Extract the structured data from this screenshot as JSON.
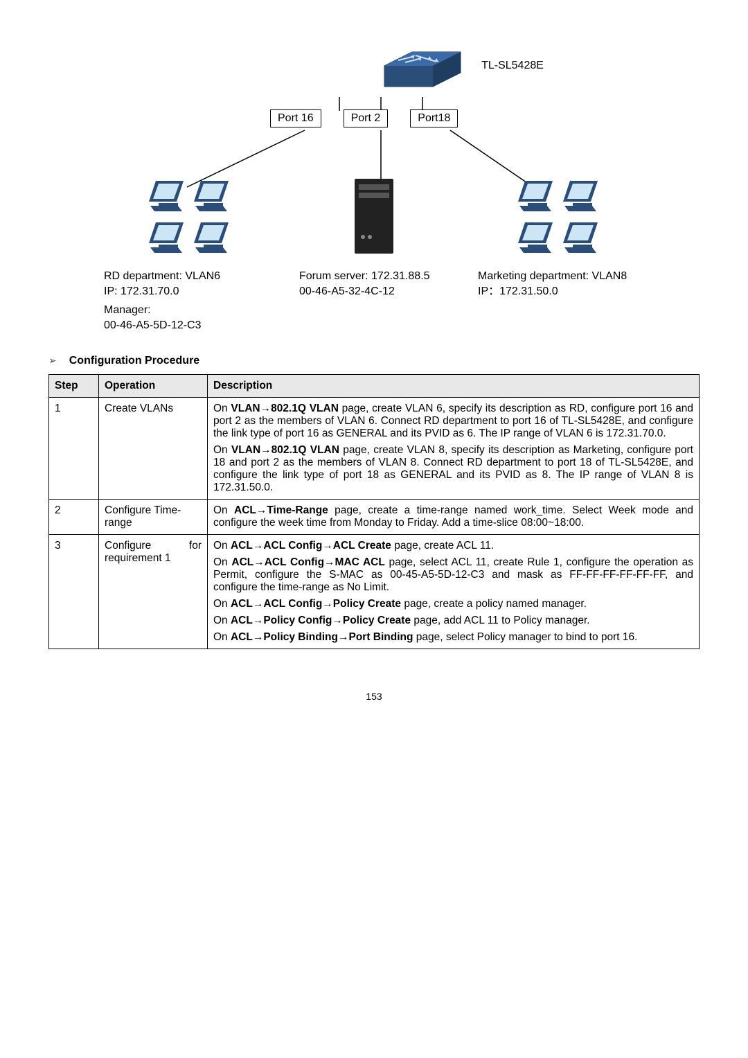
{
  "diagram": {
    "switch_label": "TL-SL5428E",
    "port16": "Port 16",
    "port2": "Port 2",
    "port18": "Port18",
    "rd_line1": "RD department: VLAN6",
    "rd_line2": "IP: 172.31.70.0",
    "manager_line1": "Manager:",
    "manager_line2": "00-46-A5-5D-12-C3",
    "forum_line1": "Forum server: 172.31.88.5",
    "forum_line2": "00-46-A5-32-4C-12",
    "mkt_line1": "Marketing department: VLAN8",
    "mkt_line2": "IP：172.31.50.0"
  },
  "procedure_heading": "Configuration Procedure",
  "table": {
    "h_step": "Step",
    "h_op": "Operation",
    "h_desc": "Description",
    "r1_step": "1",
    "r1_op": "Create VLANs",
    "r1_p1a": "On ",
    "r1_p1b": "VLAN→802.1Q VLAN",
    "r1_p1c": " page, create VLAN 6, specify its description as RD, configure port 16 and port 2 as the members of VLAN 6. Connect RD department to port 16 of TL-SL5428E, and configure the link type of port 16 as GENERAL and its PVID as 6. The IP range of VLAN 6 is 172.31.70.0.",
    "r1_p2a": "On ",
    "r1_p2b": "VLAN→802.1Q VLAN",
    "r1_p2c": " page, create VLAN 8, specify its description as Marketing, configure port 18 and port 2 as the members of VLAN 8. Connect RD department to port 18 of TL-SL5428E, and configure the link type of port 18 as GENERAL and its PVID as 8. The IP range of VLAN 8 is 172.31.50.0.",
    "r2_step": "2",
    "r2_op": "Configure Time-range",
    "r2_p1a": "On ",
    "r2_p1b": "ACL→Time-Range",
    "r2_p1c": " page, create a time-range named work_time. Select Week mode and configure the week time from Monday to Friday. Add a time-slice 08:00~18:00.",
    "r3_step": "3",
    "r3_op": "Configure for requirement 1",
    "r3_p1a": "On ",
    "r3_p1b": "ACL→ACL Config→ACL Create",
    "r3_p1c": " page, create ACL 11.",
    "r3_p2a": "On ",
    "r3_p2b": "ACL→ACL Config→MAC ACL",
    "r3_p2c": " page, select ACL 11, create Rule 1, configure the operation as Permit, configure the S-MAC as 00-45-A5-5D-12-C3 and mask as FF-FF-FF-FF-FF-FF, and configure the time-range as No Limit.",
    "r3_p3a": "On ",
    "r3_p3b": "ACL→ACL Config→Policy Create",
    "r3_p3c": " page, create a policy named manager.",
    "r3_p4a": "On ",
    "r3_p4b": "ACL→Policy Config→Policy Create",
    "r3_p4c": " page, add ACL 11 to Policy manager.",
    "r3_p5a": "On ",
    "r3_p5b": "ACL→Policy Binding→Port Binding",
    "r3_p5c": " page, select Policy manager to bind to port 16."
  },
  "page_number": "153"
}
